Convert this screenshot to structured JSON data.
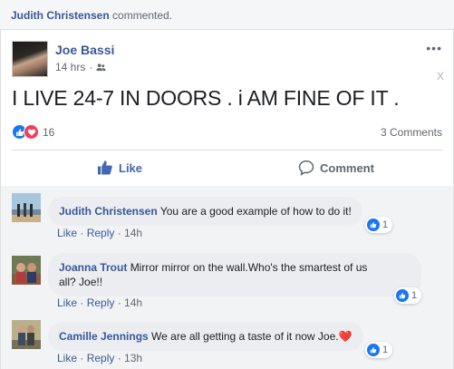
{
  "notification": {
    "actor": "Judith Christensen",
    "action": " commented."
  },
  "post": {
    "author": "Joe Bassi",
    "time": "14 hrs",
    "separator": "·",
    "privacy_icon": "friends-icon",
    "text": "I LIVE 24-7 IN DOORS . i AM FINE OF IT .",
    "more_icon": "more-icon",
    "more_glyph": "•••",
    "close_glyph": "x",
    "reaction_count": "16",
    "comments_count": "3 Comments",
    "like_label": "Like",
    "comment_label": "Comment"
  },
  "comments": [
    {
      "author": "Judith Christensen",
      "text": "You are a good example of how to do it!",
      "like_label": "Like",
      "reply_label": "Reply",
      "time": "14h",
      "reactions": "1"
    },
    {
      "author": "Joanna Trout",
      "text_line1": "Mirror mirror on the wall.Who's the smartest of us",
      "text_line2": "all? Joe!!",
      "like_label": "Like",
      "reply_label": "Reply",
      "time": "14h",
      "reactions": "1"
    },
    {
      "author": "Camille Jennings",
      "text": "We are all getting a taste of it now Joe.",
      "emoji": "❤️",
      "like_label": "Like",
      "reply_label": "Reply",
      "time": "13h",
      "reactions": "1"
    }
  ],
  "colors": {
    "link_blue": "#385898",
    "like_blue": "#1877f2",
    "love_red": "#f33e58",
    "bubble_bg": "#ebedf0",
    "comments_bg": "#f2f3f5"
  }
}
